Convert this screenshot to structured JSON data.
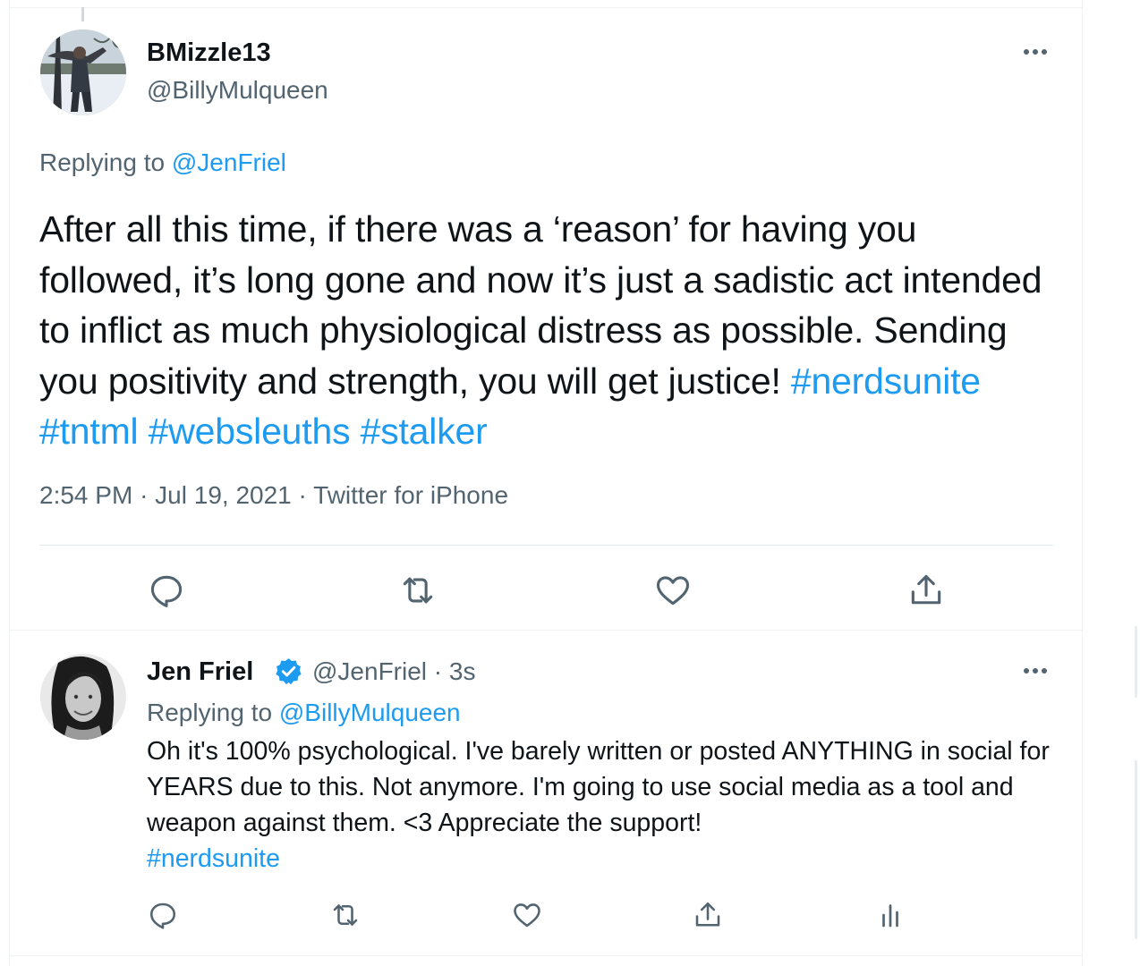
{
  "main_tweet": {
    "display_name": "BMizzle13",
    "handle": "@BillyMulqueen",
    "replying_prefix": "Replying to",
    "replying_to": "@JenFriel",
    "text": "After all this time, if there was a ‘reason’ for having you followed, it’s long gone and now it’s just a sadistic act intended to inflict as much physiological distress as possible. Sending you positivity and strength, you will get justice!",
    "hashtags": [
      "#nerdsunite",
      "#tntml",
      "#websleuths",
      "#stalker"
    ],
    "time": "2:54 PM",
    "date": "Jul 19, 2021",
    "source": "Twitter for iPhone",
    "separator": "·",
    "more_icon": "more-horizontal-icon",
    "actions": [
      "reply-icon",
      "retweet-icon",
      "like-icon",
      "share-icon"
    ]
  },
  "reply_tweet": {
    "display_name": "Jen Friel",
    "verified_icon": "verified-badge-icon",
    "handle": "@JenFriel",
    "separator": "·",
    "age": "3s",
    "replying_prefix": "Replying to",
    "replying_to": "@BillyMulqueen",
    "text": "Oh it's 100% psychological. I've barely written or posted ANYTHING in social for YEARS due to this. Not anymore. I'm going to use social media as a tool and weapon against them. <3 Appreciate the support!",
    "hashtag": "#nerdsunite",
    "more_icon": "more-horizontal-icon",
    "actions": [
      "reply-icon",
      "retweet-icon",
      "like-icon",
      "share-icon",
      "analytics-icon"
    ]
  },
  "colors": {
    "link": "#1d9bf0",
    "text": "#0f1419",
    "muted": "#536471",
    "border": "#eff3f4"
  }
}
